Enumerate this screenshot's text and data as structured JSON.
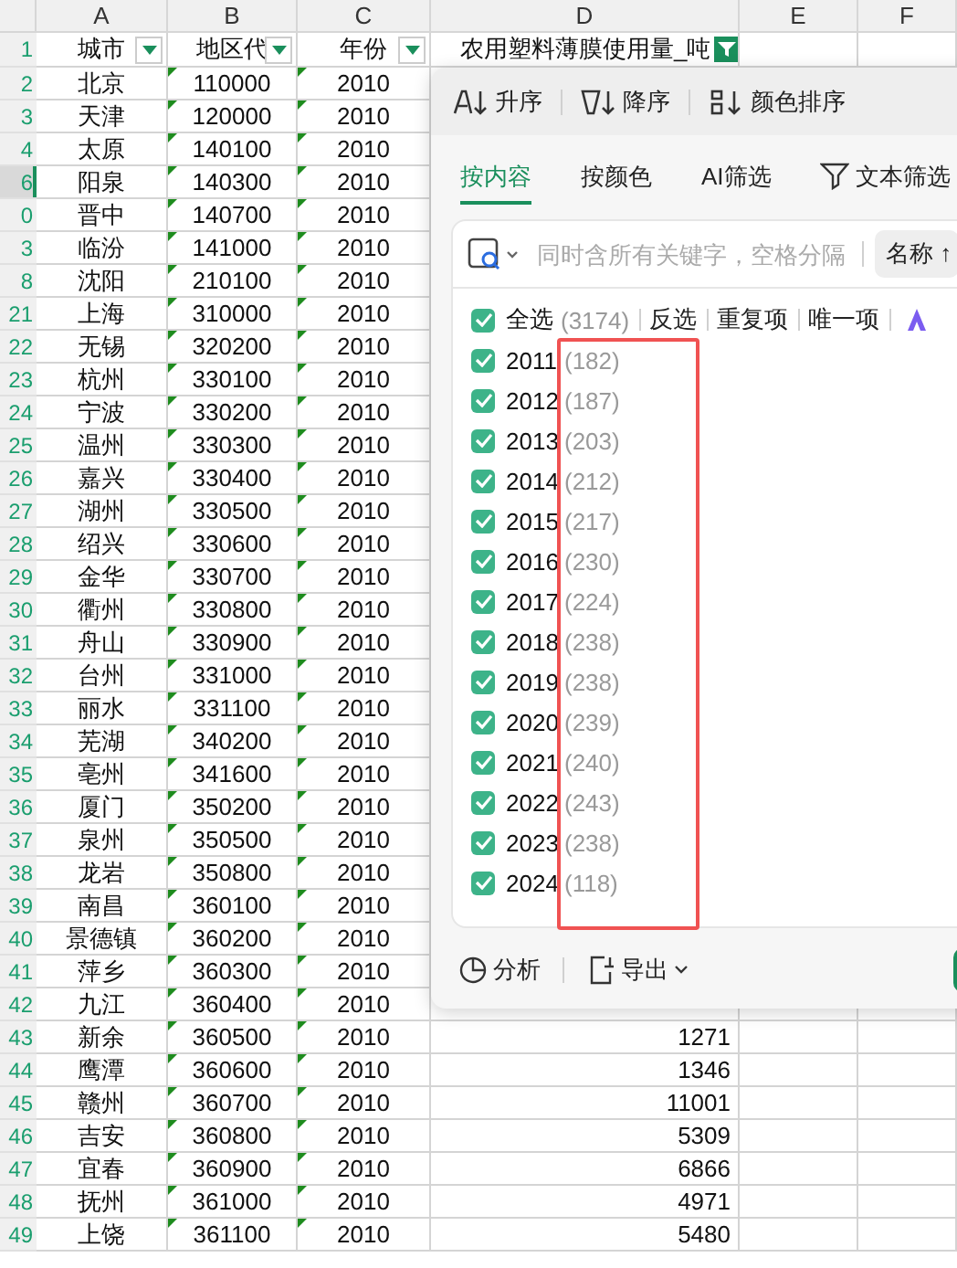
{
  "columns": [
    {
      "letter": "A"
    },
    {
      "letter": "B"
    },
    {
      "letter": "C"
    },
    {
      "letter": "D"
    },
    {
      "letter": "E"
    },
    {
      "letter": "F"
    }
  ],
  "header_row": {
    "number": "1",
    "cells": [
      {
        "text": "城市",
        "kind": "dropdown"
      },
      {
        "text": "地区代",
        "kind": "dropdown"
      },
      {
        "text": "年份",
        "kind": "dropdown"
      },
      {
        "text": "农用塑料薄膜使用量_吨",
        "kind": "filtered"
      }
    ]
  },
  "rows": [
    {
      "number": "2",
      "selected": false,
      "city": "北京",
      "code": "110000",
      "year": "2010"
    },
    {
      "number": "3",
      "selected": false,
      "city": "天津",
      "code": "120000",
      "year": "2010"
    },
    {
      "number": "4",
      "selected": false,
      "city": "太原",
      "code": "140100",
      "year": "2010"
    },
    {
      "number": "6",
      "selected": true,
      "city": "阳泉",
      "code": "140300",
      "year": "2010"
    },
    {
      "number": "0",
      "selected": false,
      "city": "晋中",
      "code": "140700",
      "year": "2010"
    },
    {
      "number": "3",
      "selected": false,
      "city": "临汾",
      "code": "141000",
      "year": "2010"
    },
    {
      "number": "8",
      "selected": false,
      "city": "沈阳",
      "code": "210100",
      "year": "2010"
    },
    {
      "number": "21",
      "selected": false,
      "city": "上海",
      "code": "310000",
      "year": "2010"
    },
    {
      "number": "22",
      "selected": false,
      "city": "无锡",
      "code": "320200",
      "year": "2010"
    },
    {
      "number": "23",
      "selected": false,
      "city": "杭州",
      "code": "330100",
      "year": "2010"
    },
    {
      "number": "24",
      "selected": false,
      "city": "宁波",
      "code": "330200",
      "year": "2010"
    },
    {
      "number": "25",
      "selected": false,
      "city": "温州",
      "code": "330300",
      "year": "2010"
    },
    {
      "number": "26",
      "selected": false,
      "city": "嘉兴",
      "code": "330400",
      "year": "2010"
    },
    {
      "number": "27",
      "selected": false,
      "city": "湖州",
      "code": "330500",
      "year": "2010"
    },
    {
      "number": "28",
      "selected": false,
      "city": "绍兴",
      "code": "330600",
      "year": "2010"
    },
    {
      "number": "29",
      "selected": false,
      "city": "金华",
      "code": "330700",
      "year": "2010"
    },
    {
      "number": "30",
      "selected": false,
      "city": "衢州",
      "code": "330800",
      "year": "2010"
    },
    {
      "number": "31",
      "selected": false,
      "city": "舟山",
      "code": "330900",
      "year": "2010"
    },
    {
      "number": "32",
      "selected": false,
      "city": "台州",
      "code": "331000",
      "year": "2010"
    },
    {
      "number": "33",
      "selected": false,
      "city": "丽水",
      "code": "331100",
      "year": "2010"
    },
    {
      "number": "34",
      "selected": false,
      "city": "芜湖",
      "code": "340200",
      "year": "2010"
    },
    {
      "number": "35",
      "selected": false,
      "city": "亳州",
      "code": "341600",
      "year": "2010"
    },
    {
      "number": "36",
      "selected": false,
      "city": "厦门",
      "code": "350200",
      "year": "2010"
    },
    {
      "number": "37",
      "selected": false,
      "city": "泉州",
      "code": "350500",
      "year": "2010"
    },
    {
      "number": "38",
      "selected": false,
      "city": "龙岩",
      "code": "350800",
      "year": "2010"
    },
    {
      "number": "39",
      "selected": false,
      "city": "南昌",
      "code": "360100",
      "year": "2010"
    },
    {
      "number": "40",
      "selected": false,
      "city": "景德镇",
      "code": "360200",
      "year": "2010"
    },
    {
      "number": "41",
      "selected": false,
      "city": "萍乡",
      "code": "360300",
      "year": "2010"
    },
    {
      "number": "42",
      "selected": false,
      "city": "九江",
      "code": "360400",
      "year": "2010"
    },
    {
      "number": "43",
      "selected": false,
      "city": "新余",
      "code": "360500",
      "year": "2010",
      "value": "1271"
    },
    {
      "number": "44",
      "selected": false,
      "city": "鹰潭",
      "code": "360600",
      "year": "2010",
      "value": "1346"
    },
    {
      "number": "45",
      "selected": false,
      "city": "赣州",
      "code": "360700",
      "year": "2010",
      "value": "11001"
    },
    {
      "number": "46",
      "selected": false,
      "city": "吉安",
      "code": "360800",
      "year": "2010",
      "value": "5309"
    },
    {
      "number": "47",
      "selected": false,
      "city": "宜春",
      "code": "360900",
      "year": "2010",
      "value": "6866"
    },
    {
      "number": "48",
      "selected": false,
      "city": "抚州",
      "code": "361000",
      "year": "2010",
      "value": "4971"
    },
    {
      "number": "49",
      "selected": false,
      "city": "上饶",
      "code": "361100",
      "year": "2010",
      "value": "5480"
    }
  ],
  "filter_panel": {
    "sort_buttons": [
      {
        "kind": "ascending",
        "label": "升序"
      },
      {
        "kind": "descending",
        "label": "降序"
      },
      {
        "kind": "color",
        "label": "颜色排序"
      }
    ],
    "tabs": [
      {
        "kind": "plain",
        "label": "按内容",
        "selected": true
      },
      {
        "kind": "plain",
        "label": "按颜色",
        "selected": false
      },
      {
        "kind": "plain",
        "label": "AI筛选",
        "selected": false
      },
      {
        "kind": "text-filter",
        "label": "文本筛选",
        "selected": false
      }
    ],
    "search": {
      "placeholder": "同时含所有关键字，空格分隔"
    },
    "sort_by": {
      "label": "名称",
      "arrow": "↑"
    },
    "select_all": {
      "label": "全选",
      "count": "(3174)",
      "checked": true
    },
    "actions": [
      "反选",
      "重复项",
      "唯一项"
    ],
    "items": [
      {
        "label": "2011",
        "count": "(182)",
        "checked": true
      },
      {
        "label": "2012",
        "count": "(187)",
        "checked": true
      },
      {
        "label": "2013",
        "count": "(203)",
        "checked": true
      },
      {
        "label": "2014",
        "count": "(212)",
        "checked": true
      },
      {
        "label": "2015",
        "count": "(217)",
        "checked": true
      },
      {
        "label": "2016",
        "count": "(230)",
        "checked": true
      },
      {
        "label": "2017",
        "count": "(224)",
        "checked": true
      },
      {
        "label": "2018",
        "count": "(238)",
        "checked": true
      },
      {
        "label": "2019",
        "count": "(238)",
        "checked": true
      },
      {
        "label": "2020",
        "count": "(239)",
        "checked": true
      },
      {
        "label": "2021",
        "count": "(240)",
        "checked": true
      },
      {
        "label": "2022",
        "count": "(243)",
        "checked": true
      },
      {
        "label": "2023",
        "count": "(238)",
        "checked": true
      },
      {
        "label": "2024",
        "count": "(118)",
        "checked": true
      }
    ],
    "footer": [
      {
        "kind": "analysis",
        "label": "分析"
      },
      {
        "kind": "export",
        "label": "导出"
      }
    ]
  }
}
